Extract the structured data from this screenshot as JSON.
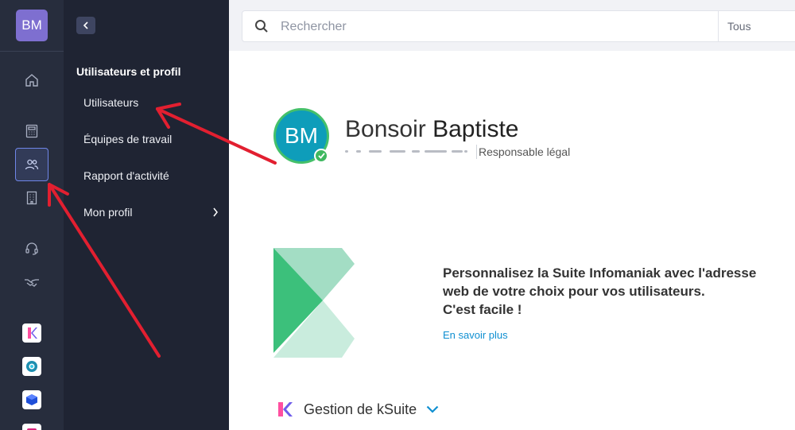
{
  "rail": {
    "avatar_initials": "BM",
    "icons": [
      "home-icon",
      "calculator-icon",
      "users-icon",
      "building-icon",
      "headset-icon",
      "handshake-icon"
    ],
    "apps": [
      "kdrive-app",
      "kchat-app",
      "cube-app",
      "kmeet-app"
    ]
  },
  "subnav": {
    "heading": "Utilisateurs et profil",
    "items": [
      {
        "label": "Utilisateurs"
      },
      {
        "label": "Équipes de travail"
      },
      {
        "label": "Rapport d'activité"
      },
      {
        "label": "Mon profil"
      }
    ]
  },
  "search": {
    "placeholder": "Rechercher",
    "scope": "Tous"
  },
  "profile": {
    "initials": "BM",
    "greeting": "Bonsoir",
    "name": "Baptiste",
    "role": "Responsable légal"
  },
  "banner": {
    "line1": "Personnalisez la Suite Infomaniak avec l'adresse",
    "line2": "web de votre choix pour vos utilisateurs.",
    "line3": "C'est facile !",
    "link": "En savoir plus"
  },
  "ksuite": {
    "title": "Gestion de kSuite"
  },
  "colors": {
    "rail_bg": "#272d3d",
    "subnav_bg": "#1f2433",
    "accent": "#0f8fd1",
    "arrow": "#e21f30",
    "avatar_bg": "#0e9dba"
  }
}
